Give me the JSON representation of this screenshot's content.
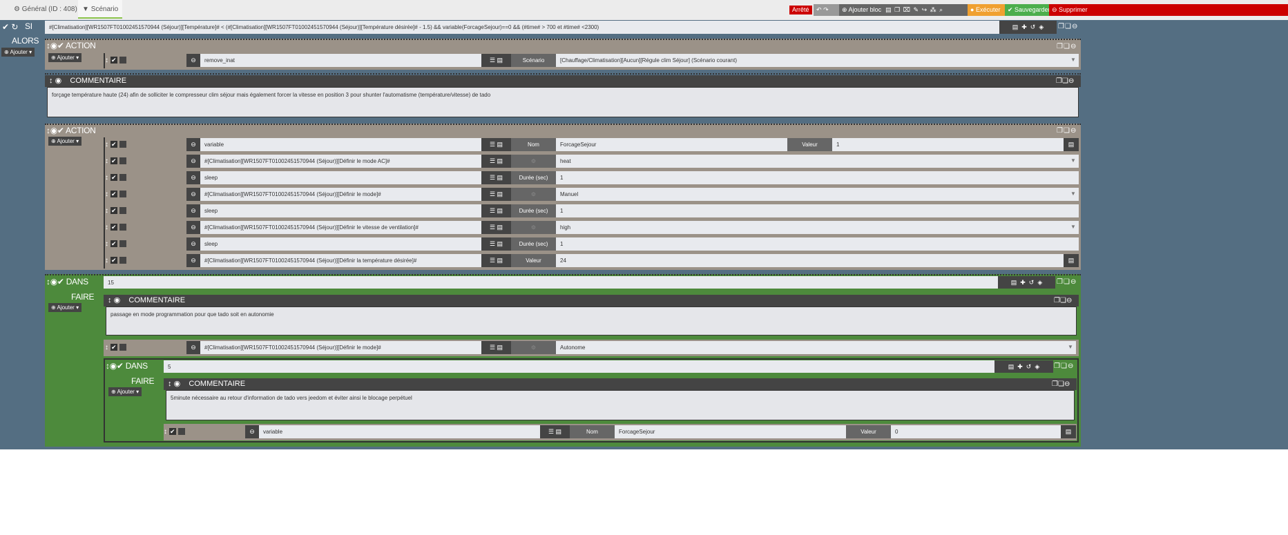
{
  "tabs": {
    "general": "Général (ID : 408)",
    "scenario": "Scénario"
  },
  "toolbar": {
    "status": "Arrêté",
    "add_block": "Ajouter bloc",
    "execute": "Exécuter",
    "save": "Sauvegarder",
    "delete": "Supprimer"
  },
  "si": {
    "label": "SI",
    "condition": "#[Climatisation][WR1507FT01002451570944 (Séjour)][Température]# < (#[Climatisation][WR1507FT01002451570944 (Séjour)][Température désirée]#  - 1.5) && variable(ForcageSejour)==0 && (#time# > 700 et #time# <2300)"
  },
  "alors": "ALORS",
  "add_label": "Ajouter",
  "action_title": "ACTION",
  "comment_title": "COMMENTAIRE",
  "dans_title": "DANS",
  "faire": "FAIRE",
  "action1": [
    {
      "cmd": "remove_inat",
      "label": "Scénario",
      "value": "[Chauffage/Climatisation][Aucun][Régule clim Séjour] (Scénario courant)",
      "select": true
    }
  ],
  "comment1": "forçage température haute (24) afin de solliciter le compresseur clim séjour mais également forcer la vitesse en position 3 pour shunter l'automatisme (température/vitesse) de tado",
  "action2": [
    {
      "cmd": "variable",
      "label": "Nom",
      "value": "ForcageSejour",
      "label2": "Valeur",
      "value2": "1"
    },
    {
      "cmd": "#[Climatisation][WR1507FT01002451570944 (Séjour)][Définir le mode AC]#",
      "icon": "fan-icon",
      "value": "heat",
      "select": true
    },
    {
      "cmd": "sleep",
      "label": "Durée (sec)",
      "value": "1"
    },
    {
      "cmd": "#[Climatisation][WR1507FT01002451570944 (Séjour)][Définir le mode]#",
      "icon": "power-icon",
      "value": "Manuel",
      "select": true
    },
    {
      "cmd": "sleep",
      "label": "Durée (sec)",
      "value": "1"
    },
    {
      "cmd": "#[Climatisation][WR1507FT01002451570944 (Séjour)][Définir le vitesse de ventilation]#",
      "icon": "fan-speed-icon",
      "value": "high",
      "select": true
    },
    {
      "cmd": "sleep",
      "label": "Durée (sec)",
      "value": "1"
    },
    {
      "cmd": "#[Climatisation][WR1507FT01002451570944 (Séjour)][Définir la température désirée]#",
      "label": "Valeur",
      "value": "24",
      "tail": true
    }
  ],
  "dans1": {
    "value": "15",
    "comment": "passage en mode programmation pour que tado soit en autonomie",
    "action": [
      {
        "cmd": "#[Climatisation][WR1507FT01002451570944 (Séjour)][Définir le mode]#",
        "icon": "power-icon",
        "value": "Autonome",
        "select": true
      }
    ]
  },
  "dans2": {
    "value": "5",
    "comment": "5minute nécessaire au retour d'information de tado vers jeedom et éviter ainsi le blocage perpétuel",
    "action": [
      {
        "cmd": "variable",
        "label": "Nom",
        "value": "ForcageSejour",
        "label2": "Valeur",
        "value2": "0"
      }
    ]
  }
}
